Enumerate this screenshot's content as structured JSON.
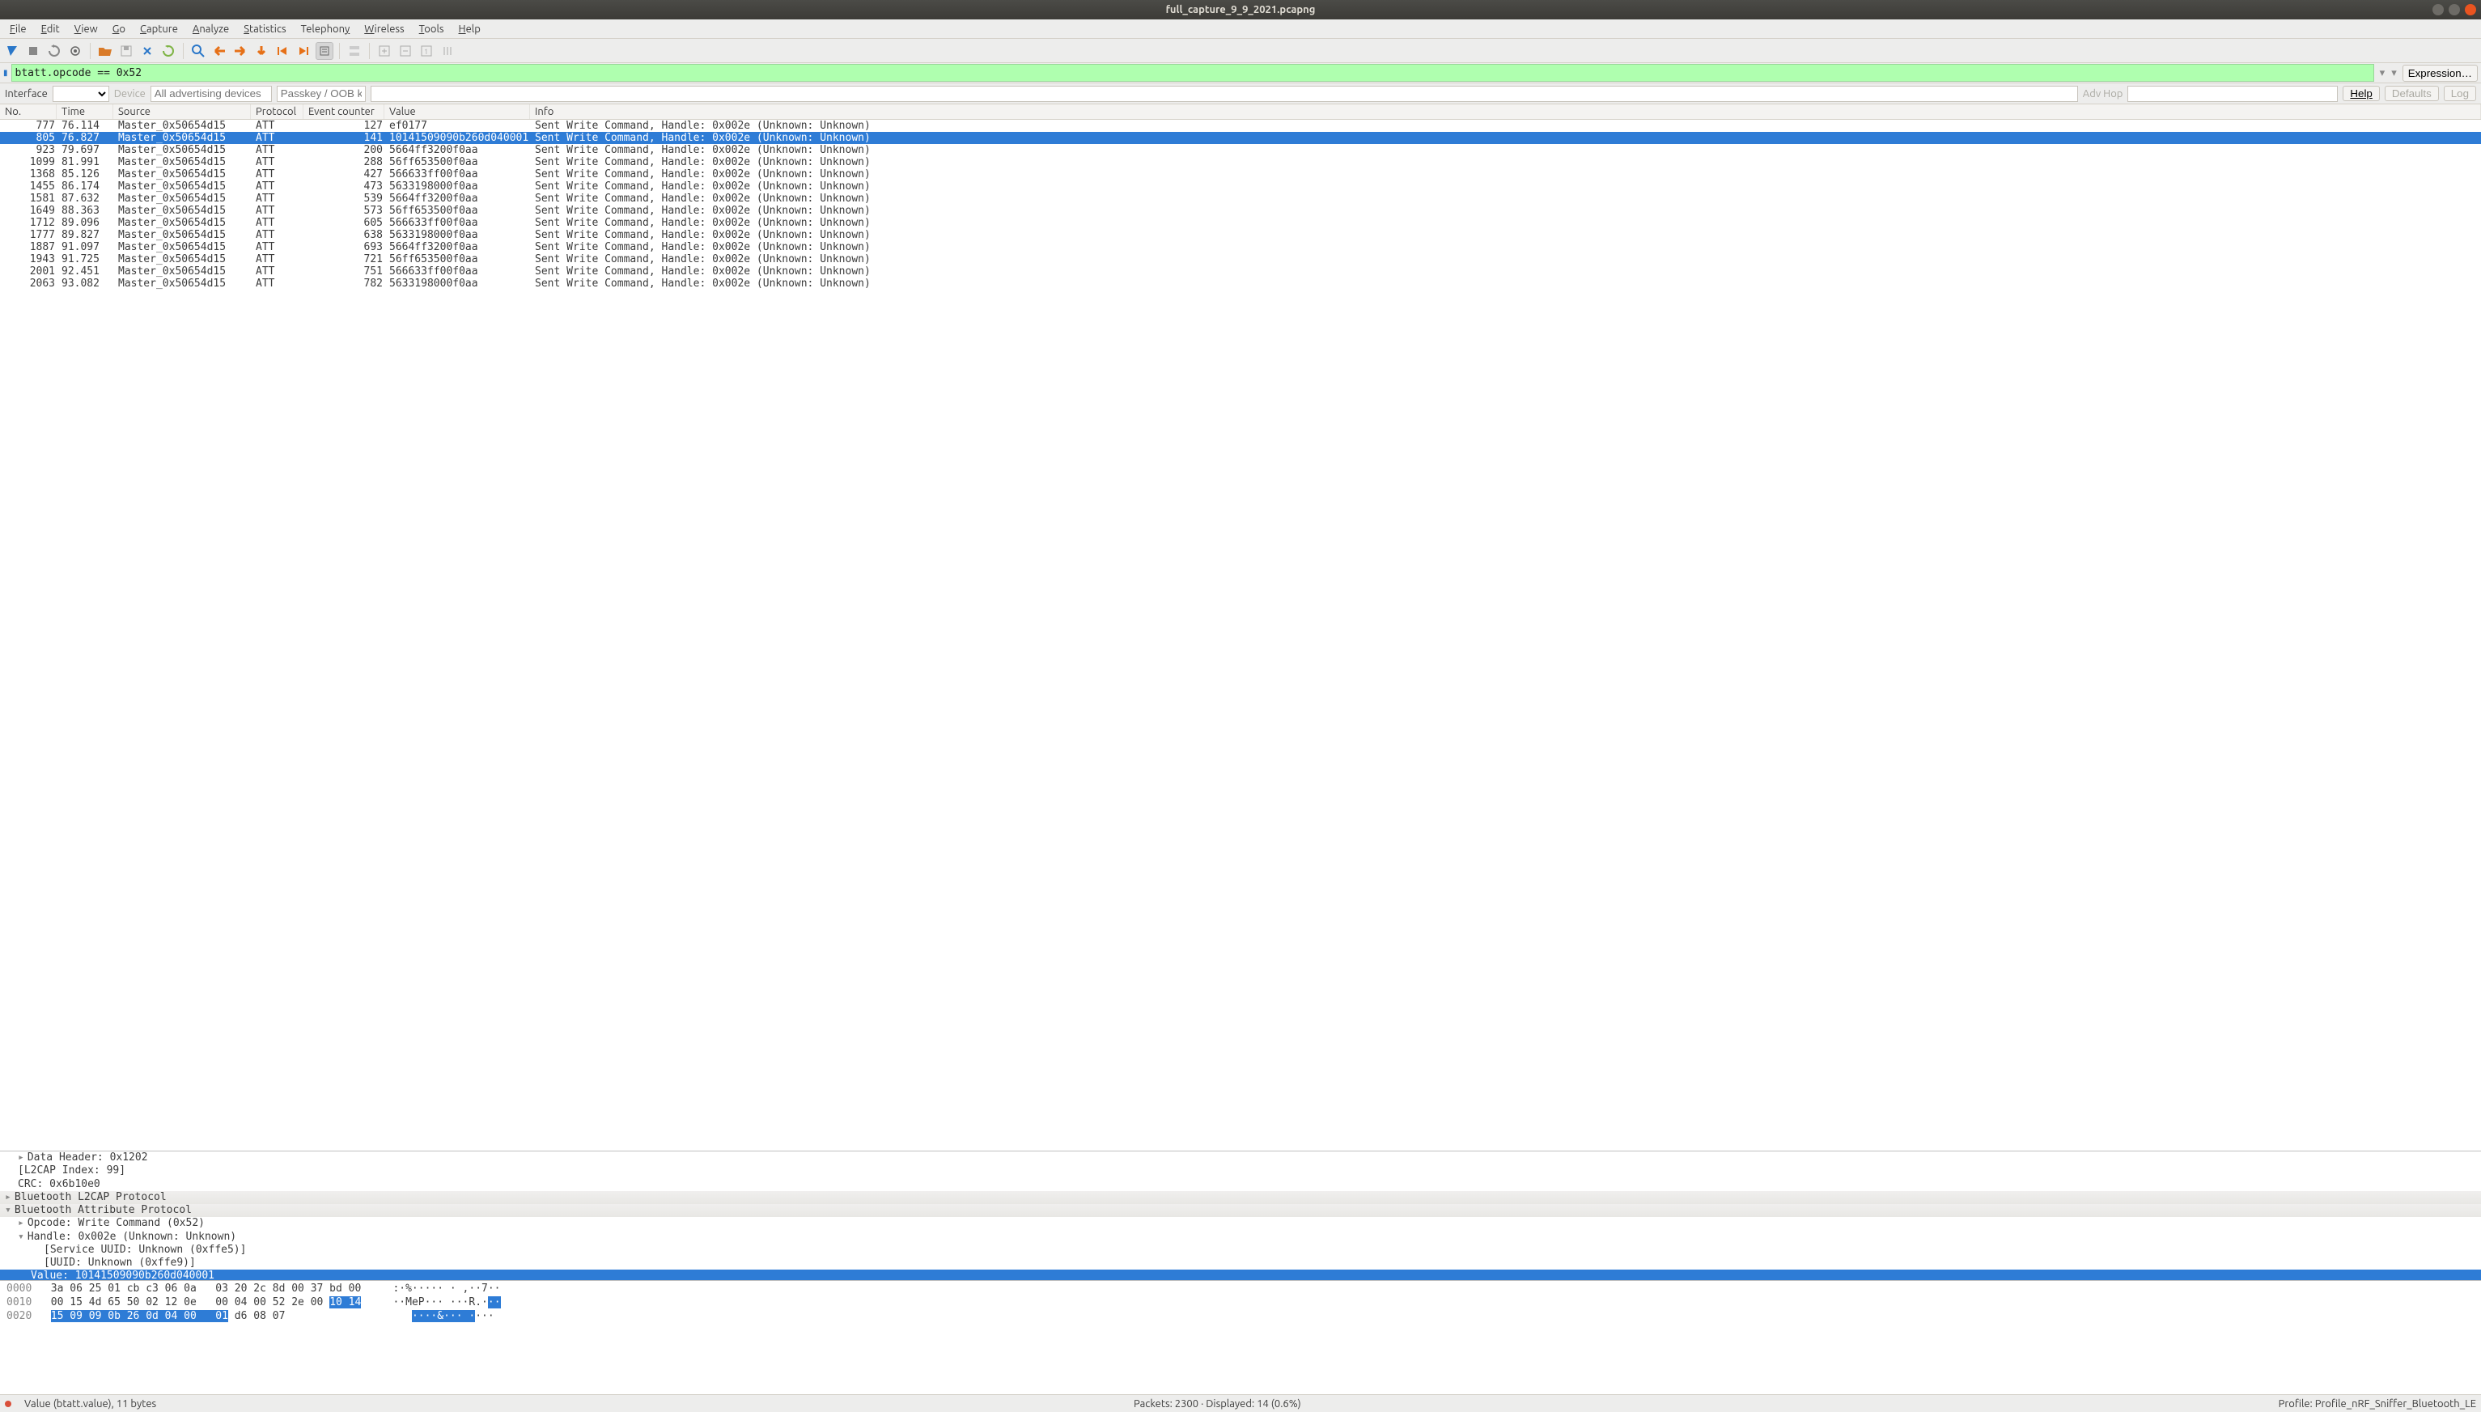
{
  "window": {
    "title": "full_capture_9_9_2021.pcapng"
  },
  "menus": [
    "File",
    "Edit",
    "View",
    "Go",
    "Capture",
    "Analyze",
    "Statistics",
    "Telephony",
    "Wireless",
    "Tools",
    "Help"
  ],
  "filter": {
    "value": "btatt.opcode == 0x52",
    "expression_label": "Expression…"
  },
  "interface_bar": {
    "label": "Interface",
    "device_label": "Device",
    "all_adv_placeholder": "All advertising devices",
    "passkey_placeholder": "Passkey / OOB key",
    "advhop_label": "Adv Hop",
    "help_label": "Help",
    "defaults_label": "Defaults",
    "log_label": "Log"
  },
  "columns": {
    "no": "No.",
    "time": "Time",
    "source": "Source",
    "protocol": "Protocol",
    "event_counter": "Event counter",
    "value": "Value",
    "info": "Info"
  },
  "packets": [
    {
      "no": "777",
      "time": "76.114",
      "source": "Master_0x50654d15",
      "protocol": "ATT",
      "evc": "127",
      "value": "ef0177",
      "info": "Sent Write Command, Handle: 0x002e (Unknown: Unknown)",
      "selected": false
    },
    {
      "no": "805",
      "time": "76.827",
      "source": "Master_0x50654d15",
      "protocol": "ATT",
      "evc": "141",
      "value": "10141509090b260d040001",
      "info": "Sent Write Command, Handle: 0x002e (Unknown: Unknown)",
      "selected": true
    },
    {
      "no": "923",
      "time": "79.697",
      "source": "Master_0x50654d15",
      "protocol": "ATT",
      "evc": "200",
      "value": "5664ff3200f0aa",
      "info": "Sent Write Command, Handle: 0x002e (Unknown: Unknown)",
      "selected": false
    },
    {
      "no": "1099",
      "time": "81.991",
      "source": "Master_0x50654d15",
      "protocol": "ATT",
      "evc": "288",
      "value": "56ff653500f0aa",
      "info": "Sent Write Command, Handle: 0x002e (Unknown: Unknown)",
      "selected": false
    },
    {
      "no": "1368",
      "time": "85.126",
      "source": "Master_0x50654d15",
      "protocol": "ATT",
      "evc": "427",
      "value": "566633ff00f0aa",
      "info": "Sent Write Command, Handle: 0x002e (Unknown: Unknown)",
      "selected": false
    },
    {
      "no": "1455",
      "time": "86.174",
      "source": "Master_0x50654d15",
      "protocol": "ATT",
      "evc": "473",
      "value": "5633198000f0aa",
      "info": "Sent Write Command, Handle: 0x002e (Unknown: Unknown)",
      "selected": false
    },
    {
      "no": "1581",
      "time": "87.632",
      "source": "Master_0x50654d15",
      "protocol": "ATT",
      "evc": "539",
      "value": "5664ff3200f0aa",
      "info": "Sent Write Command, Handle: 0x002e (Unknown: Unknown)",
      "selected": false
    },
    {
      "no": "1649",
      "time": "88.363",
      "source": "Master_0x50654d15",
      "protocol": "ATT",
      "evc": "573",
      "value": "56ff653500f0aa",
      "info": "Sent Write Command, Handle: 0x002e (Unknown: Unknown)",
      "selected": false
    },
    {
      "no": "1712",
      "time": "89.096",
      "source": "Master_0x50654d15",
      "protocol": "ATT",
      "evc": "605",
      "value": "566633ff00f0aa",
      "info": "Sent Write Command, Handle: 0x002e (Unknown: Unknown)",
      "selected": false
    },
    {
      "no": "1777",
      "time": "89.827",
      "source": "Master_0x50654d15",
      "protocol": "ATT",
      "evc": "638",
      "value": "5633198000f0aa",
      "info": "Sent Write Command, Handle: 0x002e (Unknown: Unknown)",
      "selected": false
    },
    {
      "no": "1887",
      "time": "91.097",
      "source": "Master_0x50654d15",
      "protocol": "ATT",
      "evc": "693",
      "value": "5664ff3200f0aa",
      "info": "Sent Write Command, Handle: 0x002e (Unknown: Unknown)",
      "selected": false
    },
    {
      "no": "1943",
      "time": "91.725",
      "source": "Master_0x50654d15",
      "protocol": "ATT",
      "evc": "721",
      "value": "56ff653500f0aa",
      "info": "Sent Write Command, Handle: 0x002e (Unknown: Unknown)",
      "selected": false
    },
    {
      "no": "2001",
      "time": "92.451",
      "source": "Master_0x50654d15",
      "protocol": "ATT",
      "evc": "751",
      "value": "566633ff00f0aa",
      "info": "Sent Write Command, Handle: 0x002e (Unknown: Unknown)",
      "selected": false
    },
    {
      "no": "2063",
      "time": "93.082",
      "source": "Master_0x50654d15",
      "protocol": "ATT",
      "evc": "782",
      "value": "5633198000f0aa",
      "info": "Sent Write Command, Handle: 0x002e (Unknown: Unknown)",
      "selected": false
    }
  ],
  "details": {
    "data_header": "Data Header: 0x1202",
    "l2cap_index": "[L2CAP Index: 99]",
    "crc": "CRC: 0x6b10e0",
    "l2cap_proto": "Bluetooth L2CAP Protocol",
    "att_proto": "Bluetooth Attribute Protocol",
    "opcode": "Opcode: Write Command (0x52)",
    "handle": "Handle: 0x002e (Unknown: Unknown)",
    "service_uuid": "[Service UUID: Unknown (0xffe5)]",
    "uuid": "[UUID: Unknown (0xffe9)]",
    "value_line": "Value: 10141509090b260d040001"
  },
  "hex": {
    "rows": [
      {
        "off": "0000",
        "b1": "3a 06 25 01 cb c3 06 0a",
        "b2": "03 20 2c 8d 00 37 bd 00",
        "asc": ":·%····· · ,··7··"
      },
      {
        "off": "0010",
        "b1": "00 15 4d 65 50 02 12 0e",
        "b2a": "00 04 00 52 2e 00 ",
        "b2b": "10 14",
        "asc_a": "··MeP··· ···R.·",
        "asc_b": "··"
      },
      {
        "off": "0020",
        "b1a": "15 09 09 0b 26 0d 04 00",
        "b1b": "01",
        "b2": " d6 08 07",
        "asc_a": "····&··· ·",
        "asc_b": "···"
      }
    ]
  },
  "status": {
    "left": "Value (btatt.value), 11 bytes",
    "center": "Packets: 2300 · Displayed: 14 (0.6%)",
    "right": "Profile: Profile_nRF_Sniffer_Bluetooth_LE"
  }
}
